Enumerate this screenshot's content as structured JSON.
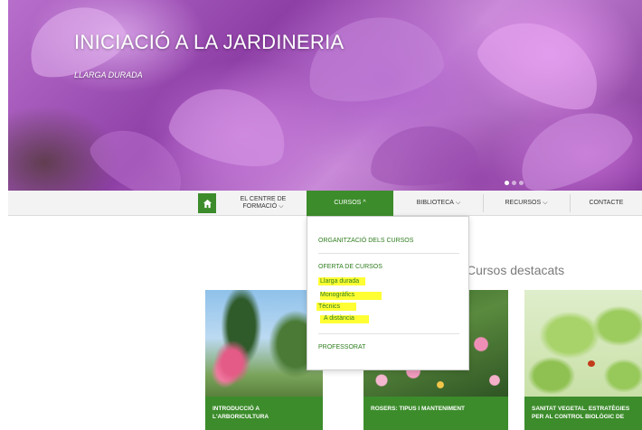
{
  "hero": {
    "title": "INICIACIÓ A LA JARDINERIA",
    "subtitle": "LLARGA DURADA",
    "slides": 3,
    "active_slide": 1
  },
  "nav": {
    "home_icon": "home-icon",
    "items": [
      {
        "label": "EL CENTRE DE FORMACIÓ",
        "line1": "EL CENTRE DE",
        "line2": "FORMACIÓ",
        "caret": "⌵",
        "active": false
      },
      {
        "label": "CURSOS",
        "caret": "^",
        "active": true
      },
      {
        "label": "BIBLIOTECA",
        "caret": "⌵",
        "active": false
      },
      {
        "label": "RECURSOS",
        "caret": "⌵",
        "active": false
      },
      {
        "label": "CONTACTE",
        "caret": "",
        "active": false
      }
    ]
  },
  "dropdown": {
    "organitzacio": "ORGANITZACIÓ DELS CURSOS",
    "oferta": "OFERTA DE CURSOS",
    "subitems": [
      "Llarga durada",
      "Monogràfics",
      "Tècnics",
      "A distància"
    ],
    "professorat": "PROFESSORAT"
  },
  "featured": {
    "title": "Cursos destacats",
    "cards": [
      {
        "caption": "INTRODUCCIÓ A L'ARBORICULTURA"
      },
      {
        "caption": "ROSERS: TIPUS I MANTENIMENT"
      },
      {
        "caption": "SANITAT VEGETAL. ESTRATÈGIES PER AL CONTROL BIOLÒGIC DE"
      }
    ]
  },
  "colors": {
    "brand_green": "#3c8c2b",
    "link_green": "#2e7d1e",
    "highlight": "#ffff33"
  }
}
